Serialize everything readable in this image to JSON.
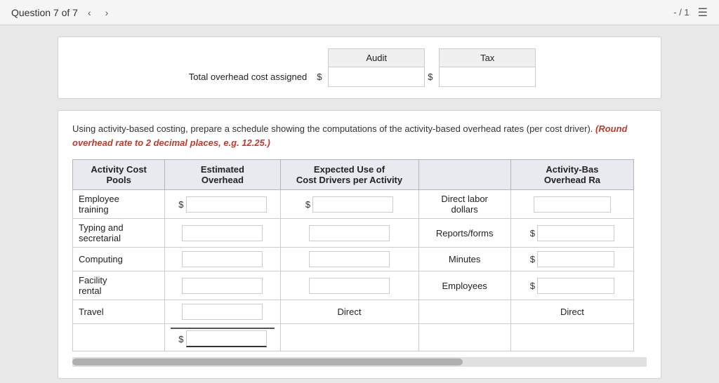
{
  "topbar": {
    "title": "Question 7 of 7",
    "prev_label": "‹",
    "next_label": "›",
    "page_info": "- / 1",
    "list_icon": "☰"
  },
  "overhead_section": {
    "col_audit": "Audit",
    "col_tax": "Tax",
    "row_label": "Total overhead cost assigned",
    "dollar_sign": "$"
  },
  "instructions": {
    "main": "Using activity-based costing, prepare a schedule showing the computations of the activity-based overhead rates (per cost driver).",
    "note": "(Round overhead rate to 2 decimal places, e.g. 12.25.)"
  },
  "activity_table": {
    "headers": {
      "col1": "Activity Cost Pools",
      "col2_line1": "Estimated",
      "col2_line2": "Overhead",
      "col3_line1": "Expected Use of",
      "col3_line2": "Cost Drivers per Activity",
      "col4_line1": "Activity-Bas",
      "col4_line2": "Overhead Ra"
    },
    "rows": [
      {
        "label": "Employee training",
        "has_dollar_est": true,
        "has_dollar_exp": true,
        "driver": "Direct labor dollars",
        "has_dollar_rate": false,
        "rate_text": ""
      },
      {
        "label": "Typing and secretarial",
        "has_dollar_est": false,
        "has_dollar_exp": false,
        "driver": "Reports/forms",
        "has_dollar_rate": true,
        "rate_text": ""
      },
      {
        "label": "Computing",
        "has_dollar_est": false,
        "has_dollar_exp": false,
        "driver": "Minutes",
        "has_dollar_rate": true,
        "rate_text": ""
      },
      {
        "label": "Facility rental",
        "has_dollar_est": false,
        "has_dollar_exp": false,
        "driver": "Employees",
        "has_dollar_rate": true,
        "rate_text": ""
      },
      {
        "label": "Travel",
        "has_dollar_est": false,
        "has_dollar_exp": false,
        "driver": "Direct",
        "driver_static": true,
        "has_dollar_rate": false,
        "rate_text": "Direct",
        "rate_static": true
      }
    ],
    "total_dollar_sign": "$"
  }
}
